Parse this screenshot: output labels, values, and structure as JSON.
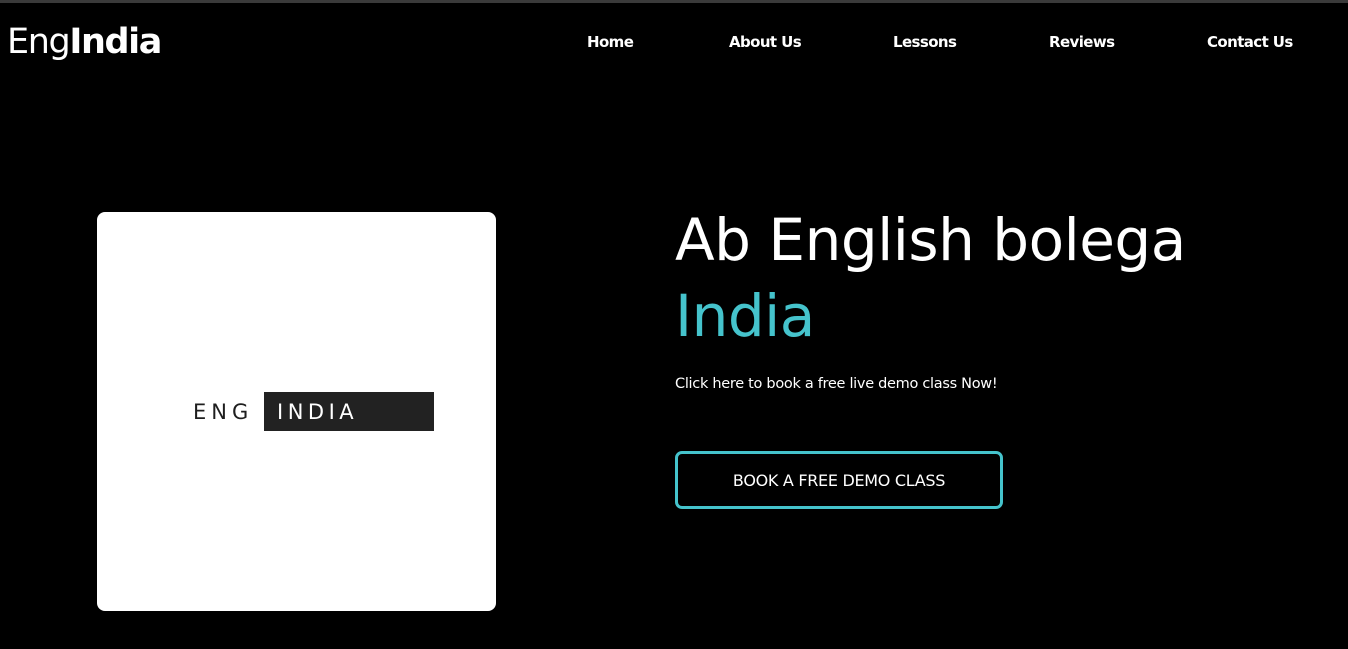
{
  "header": {
    "brand_prefix": "Eng",
    "brand_suffix": "India"
  },
  "nav": {
    "home": "Home",
    "about": "About Us",
    "lessons": "Lessons",
    "reviews": "Reviews",
    "contact": "Contact Us"
  },
  "hero": {
    "logo_eng": "ENG",
    "logo_india": "INDIA",
    "title": "Ab English bolega",
    "title_accent": "India",
    "subtitle": "Click here to book a free live demo class Now!",
    "cta_label": "BOOK A FREE DEMO CLASS"
  },
  "colors": {
    "background": "#000000",
    "accent": "#45c3cc",
    "text": "#ffffff",
    "card": "#ffffff",
    "logo_box": "#222222"
  }
}
